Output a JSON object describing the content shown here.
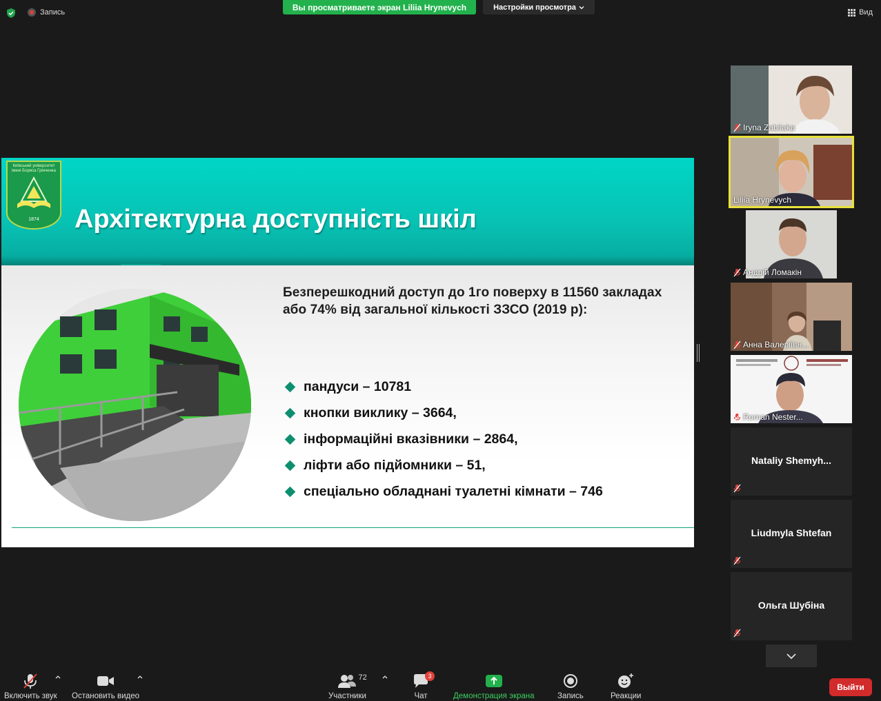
{
  "top_bar": {
    "recording_label": "Запись",
    "share_banner": "Вы просматриваете экран Liliia Hrynevych",
    "view_settings": "Настройки просмотра",
    "view_label": "Вид"
  },
  "slide": {
    "logo_text": [
      "Київський університет",
      "імені Бориса Грінченка"
    ],
    "logo_year": "1874",
    "title": "Архітектурна доступність шкіл",
    "intro": "Безперешкодний доступ до 1го поверху в 11560 закладах  або 74% від загальної кількості ЗЗСО  (2019 р):",
    "bullets": [
      "пандуси – 10781",
      "кнопки виклику – 3664,",
      "інформаційні вказівники – 2864,",
      "ліфти або підйомники – 51,",
      "спеціально обладнані туалетні кімнати – 746"
    ],
    "accent_color": "#0d8f6f"
  },
  "participants": [
    {
      "name": "Iryna Zabiiaka",
      "muted": true,
      "video": true
    },
    {
      "name": "Liliia Hrynevych",
      "muted": false,
      "video": true,
      "active_speaker": true
    },
    {
      "name": "Андрій Ломакін",
      "muted": true,
      "video": true
    },
    {
      "name": "Анна Валеріївн...",
      "muted": true,
      "video": true
    },
    {
      "name": "Roman Nester...",
      "muted": true,
      "video": true
    },
    {
      "name": "Nataliy  Shemyh...",
      "muted": true,
      "video": false
    },
    {
      "name": "Liudmyla Shtefan",
      "muted": true,
      "video": false
    },
    {
      "name": "Ольга Шубіна",
      "muted": true,
      "video": false
    }
  ],
  "toolbar": {
    "unmute": "Включить звук",
    "stop_video": "Остановить видео",
    "participants": "Участники",
    "participants_count": "72",
    "chat": "Чат",
    "chat_badge": "3",
    "share_screen": "Демонстрация экрана",
    "record": "Запись",
    "reactions": "Реакции",
    "leave": "Выйти"
  }
}
